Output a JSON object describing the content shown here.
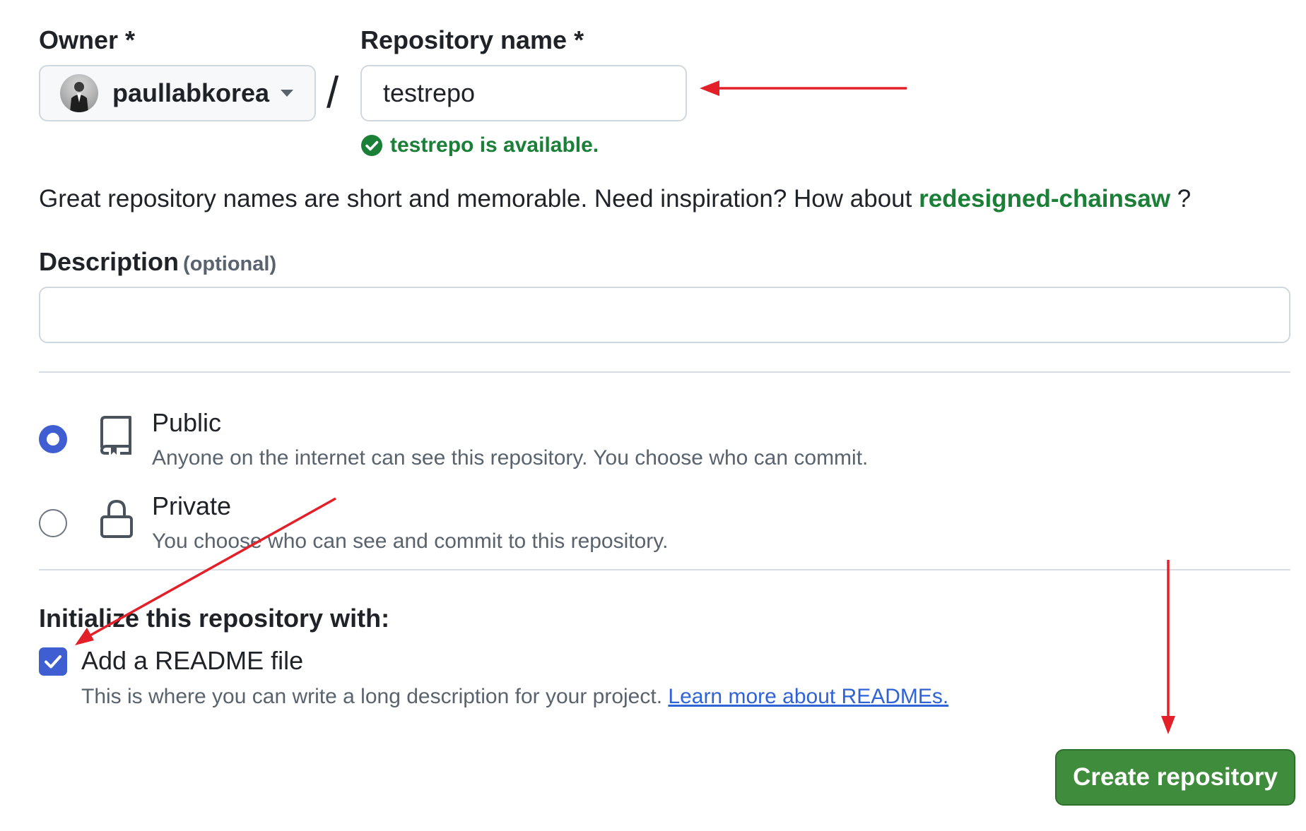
{
  "owner": {
    "label": "Owner *",
    "selected": "paullabkorea"
  },
  "separator": "/",
  "repo_name": {
    "label": "Repository name *",
    "value": "testrepo",
    "availability": "testrepo is available."
  },
  "hint": {
    "text": "Great repository names are short and memorable. Need inspiration? How about",
    "suggestion": "redesigned-chainsaw",
    "suffix": "?"
  },
  "description": {
    "label": "Description",
    "optional": "(optional)",
    "value": ""
  },
  "visibility": {
    "selected": "public",
    "public": {
      "title": "Public",
      "desc": "Anyone on the internet can see this repository. You choose who can commit."
    },
    "private": {
      "title": "Private",
      "desc": "You choose who can see and commit to this repository."
    }
  },
  "initialize": {
    "label": "Initialize this repository with:",
    "readme": {
      "checked": true,
      "title": "Add a README file",
      "desc": "This is where you can write a long description for your project.",
      "link": "Learn more about READMEs."
    }
  },
  "submit": {
    "label": "Create repository"
  },
  "colors": {
    "accent_blue": "#3f5ed1",
    "success_green": "#1a7f37",
    "button_green": "#3f8c3d",
    "annotation_red": "#e3202a"
  },
  "icons": {
    "owner_caret": "chevron-down-icon",
    "availability": "check-circle-icon",
    "public": "repo-icon",
    "private": "lock-icon",
    "readme_checkbox": "checkmark-icon"
  }
}
